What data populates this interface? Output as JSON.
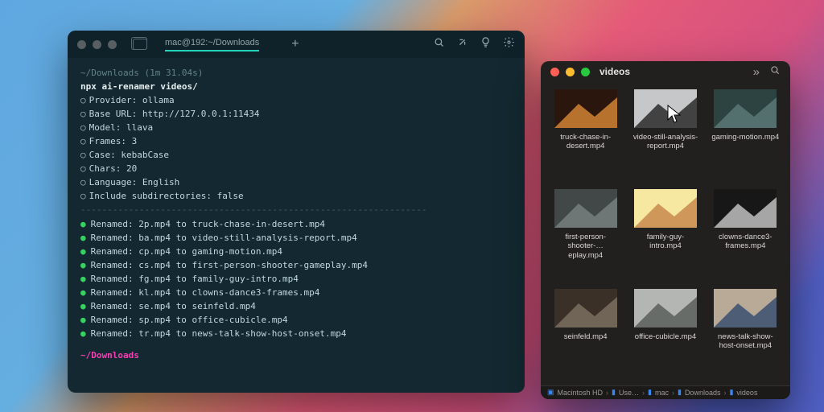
{
  "terminal": {
    "tab_title": "mac@192:~/Downloads",
    "traffic": {
      "close": "#575f62",
      "min": "#575f62",
      "max": "#575f62"
    },
    "prompt_header": "~/Downloads (1m 31.04s)",
    "command": "npx ai-renamer videos/",
    "settings": [
      "Provider: ollama",
      "Base URL: http://127.0.0.1:11434",
      "Model: llava",
      "Frames: 3",
      "Case: kebabCase",
      "Chars: 20",
      "Language: English",
      "Include subdirectories: false"
    ],
    "renamed": [
      "Renamed: 2p.mp4 to truck-chase-in-desert.mp4",
      "Renamed: ba.mp4 to video-still-analysis-report.mp4",
      "Renamed: cp.mp4 to gaming-motion.mp4",
      "Renamed: cs.mp4 to first-person-shooter-gameplay.mp4",
      "Renamed: fg.mp4 to family-guy-intro.mp4",
      "Renamed: kl.mp4 to clowns-dance3-frames.mp4",
      "Renamed: se.mp4 to seinfeld.mp4",
      "Renamed: sp.mp4 to office-cubicle.mp4",
      "Renamed: tr.mp4 to news-talk-show-host-onset.mp4"
    ],
    "prompt_footer": "~/Downloads"
  },
  "finder": {
    "title": "videos",
    "traffic": {
      "close": "#ff5f57",
      "min": "#febc2e",
      "max": "#28c840"
    },
    "files": [
      {
        "name": "truck-chase-in-desert.mp4",
        "c1": "#2a160c",
        "c2": "#d08334"
      },
      {
        "name": "video-still-analysis-report.mp4",
        "c1": "#c5c7c8",
        "c2": "#2a2a2a"
      },
      {
        "name": "gaming-motion.mp4",
        "c1": "#2d4342",
        "c2": "#5a7876"
      },
      {
        "name": "first-person-shooter-…eplay.mp4",
        "c1": "#424748",
        "c2": "#76807e"
      },
      {
        "name": "family-guy-intro.mp4",
        "c1": "#f6e8a0",
        "c2": "#c88a4e"
      },
      {
        "name": "clowns-dance3-frames.mp4",
        "c1": "#171717",
        "c2": "#c0c0c0"
      },
      {
        "name": "seinfeld.mp4",
        "c1": "#3a3028",
        "c2": "#7a6f5f"
      },
      {
        "name": "office-cubicle.mp4",
        "c1": "#b4b6b4",
        "c2": "#5b5f5c"
      },
      {
        "name": "news-talk-show-host-onset.mp4",
        "c1": "#b9a997",
        "c2": "#3a506e"
      }
    ],
    "path": [
      "Macintosh HD",
      "Use…",
      "mac",
      "Downloads",
      "videos"
    ]
  }
}
